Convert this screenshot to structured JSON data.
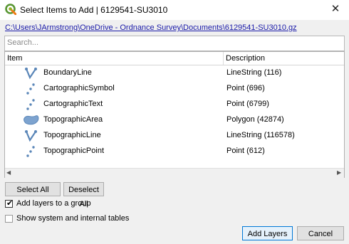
{
  "window": {
    "title": "Select Items to Add | 6129541-SU3010",
    "close_glyph": "✕"
  },
  "source_path": "C:\\Users\\JArmstrong\\OneDrive - Ordnance Survey\\Documents\\6129541-SU3010.gz",
  "search": {
    "placeholder": "Search...",
    "value": ""
  },
  "table": {
    "headers": {
      "item": "Item",
      "description": "Description"
    },
    "rows": [
      {
        "name": "BoundaryLine",
        "description": "LineString (116)",
        "icon": "line-geometry-icon"
      },
      {
        "name": "CartographicSymbol",
        "description": "Point (696)",
        "icon": "point-geometry-icon"
      },
      {
        "name": "CartographicText",
        "description": "Point (6799)",
        "icon": "point-geometry-icon"
      },
      {
        "name": "TopographicArea",
        "description": "Polygon (42874)",
        "icon": "polygon-geometry-icon"
      },
      {
        "name": "TopographicLine",
        "description": "LineString (116578)",
        "icon": "line-geometry-icon"
      },
      {
        "name": "TopographicPoint",
        "description": "Point (612)",
        "icon": "point-geometry-icon"
      }
    ]
  },
  "buttons": {
    "select_all": "Select All",
    "deselect_all": "Deselect All",
    "add_layers": "Add Layers",
    "cancel": "Cancel"
  },
  "options": {
    "add_to_group": {
      "label": "Add layers to a group",
      "checked": true
    },
    "show_system": {
      "label": "Show system and internal tables",
      "checked": false
    }
  },
  "colors": {
    "geometry_icon": "#5a86b8",
    "link": "#1a1aa8",
    "default_button_border": "#0078d7"
  }
}
